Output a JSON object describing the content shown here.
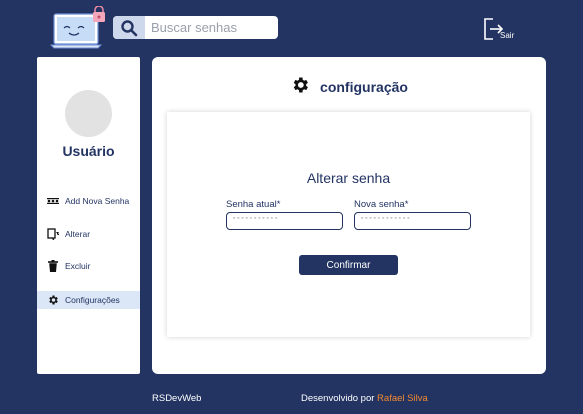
{
  "header": {
    "search": {
      "placeholder": "Buscar senhas",
      "value": ""
    },
    "logout_label": "Sair"
  },
  "sidebar": {
    "username": "Usuário",
    "items": [
      {
        "label": "Add Nova Senha",
        "icon": "password-dots-icon",
        "active": false
      },
      {
        "label": "Alterar",
        "icon": "edit-refresh-icon",
        "active": false
      },
      {
        "label": "Excluir",
        "icon": "trash-icon",
        "active": false
      },
      {
        "label": "Configurações",
        "icon": "gear-icon",
        "active": true
      }
    ]
  },
  "main": {
    "title": "configuração",
    "form": {
      "title": "Alterar senha",
      "current_label": "Senha atual*",
      "current_placeholder": "***********",
      "new_label": "Nova senha*",
      "new_placeholder": "************",
      "confirm_label": "Confirmar"
    }
  },
  "footer": {
    "brand": "RSDevWeb",
    "credit_prefix": "Desenvolvido por",
    "author": "Rafael Silva"
  },
  "colors": {
    "background": "#233463",
    "accent": "#233463",
    "active_item": "#dbe6f6",
    "author": "#f28a2e"
  }
}
